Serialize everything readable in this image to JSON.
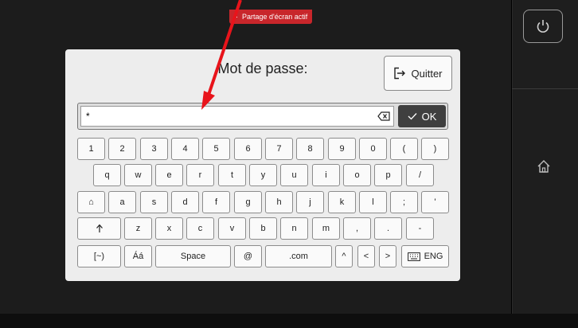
{
  "share_badge": {
    "text": "Partage d'écran actif"
  },
  "dialog": {
    "title": "Mot de passe:",
    "quit_label": "Quitter",
    "password_value": "*",
    "ok_label": "OK"
  },
  "keyboard": {
    "row1": [
      "1",
      "2",
      "3",
      "4",
      "5",
      "6",
      "7",
      "8",
      "9",
      "0",
      "(",
      ")"
    ],
    "row2": [
      "q",
      "w",
      "e",
      "r",
      "t",
      "y",
      "u",
      "i",
      "o",
      "p",
      "/"
    ],
    "row3": [
      "a",
      "s",
      "d",
      "f",
      "g",
      "h",
      "j",
      "k",
      "l",
      ";",
      "'"
    ],
    "row4": [
      "z",
      "x",
      "c",
      "v",
      "b",
      "n",
      "m",
      ",",
      ".",
      "-"
    ],
    "shift_label": "⌂",
    "symbols_label": "[~)",
    "accent_label": "Áá",
    "space_label": "Space",
    "at_label": "@",
    "dotcom_label": ".com",
    "caret_label": "^",
    "left_label": "<",
    "right_label": ">",
    "lang_label": "ENG"
  },
  "colors": {
    "badge_red": "#c8262b",
    "ok_dark": "#3f3f3f",
    "arrow_red": "#e8141b"
  },
  "icons": {
    "power": "power-icon",
    "home": "home-icon",
    "exit": "exit-icon",
    "clear": "backspace-icon",
    "check": "check-icon",
    "up": "up-arrow-icon",
    "keyboard": "keyboard-icon"
  }
}
